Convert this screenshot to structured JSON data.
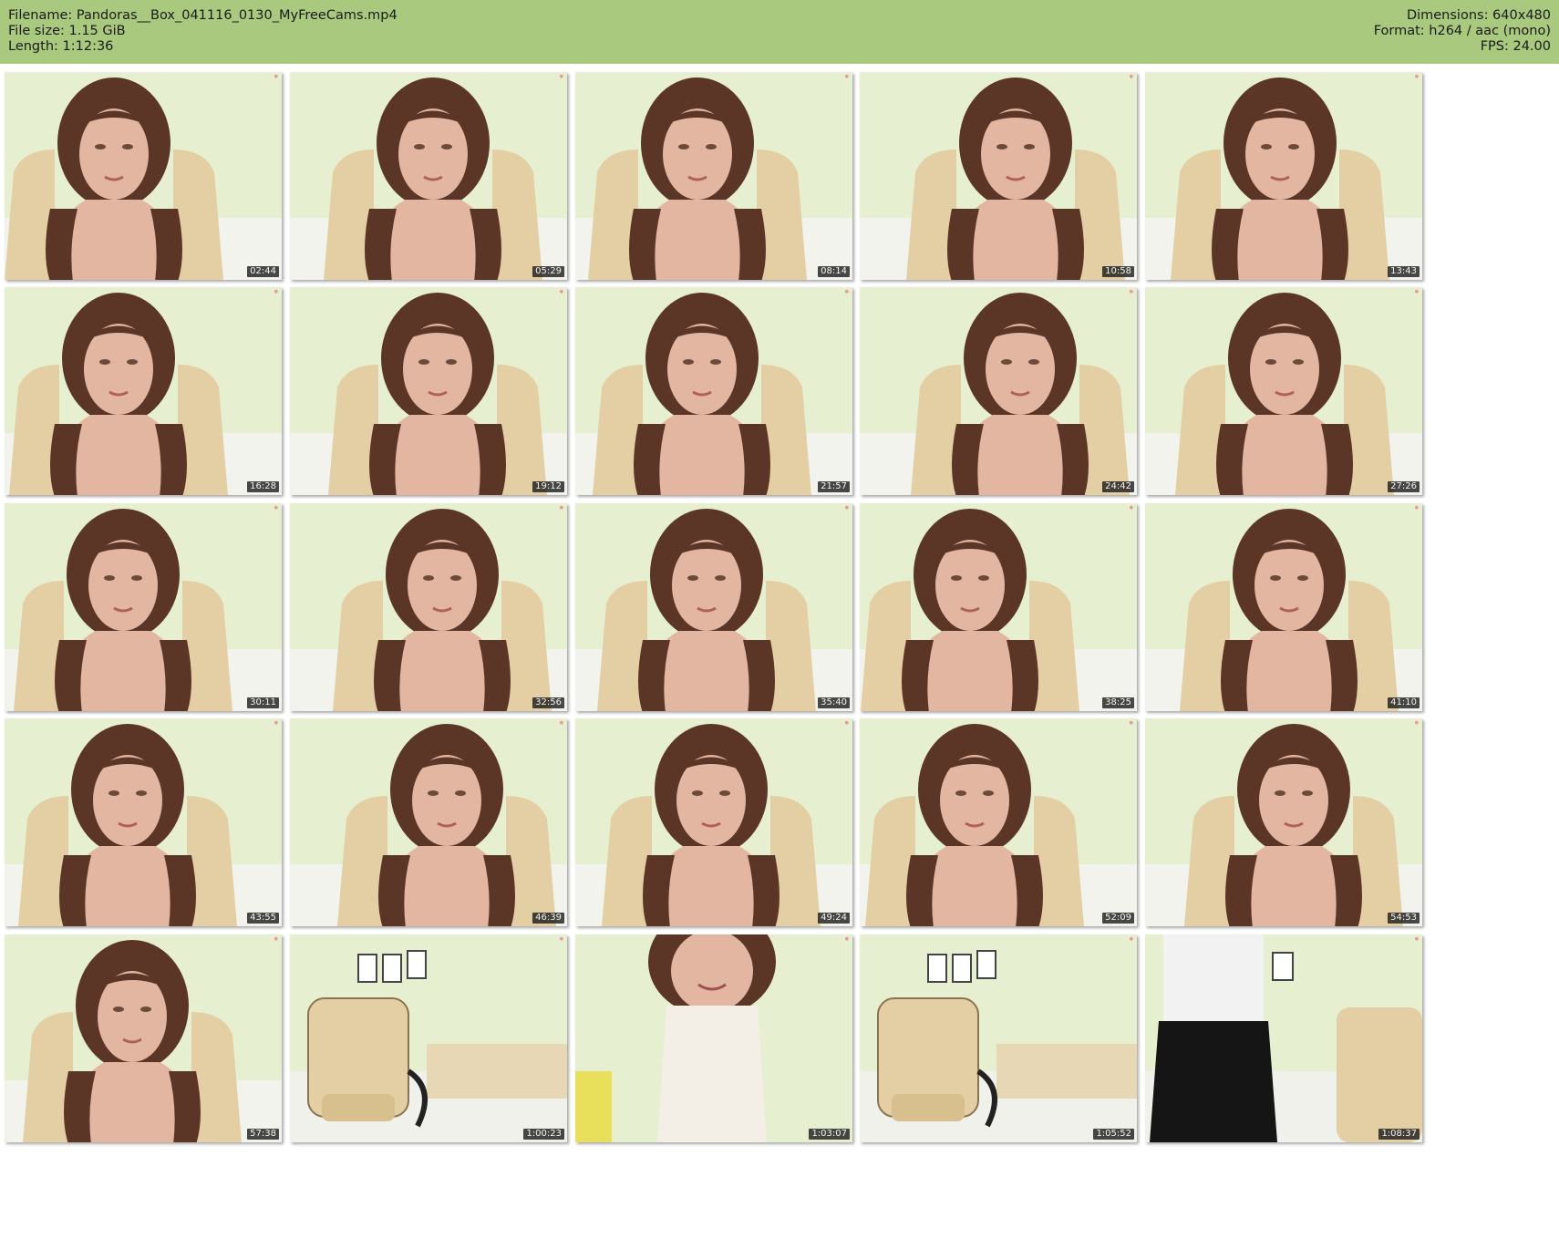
{
  "header": {
    "filename": "Filename: Pandoras__Box_041116_0130_MyFreeCams.mp4",
    "filesize": "File size: 1.15 GiB",
    "length": "Length: 1:12:36",
    "dimensions": "Dimensions: 640x480",
    "format": "Format: h264 / aac (mono)",
    "fps": "FPS: 24.00"
  },
  "colors": {
    "header_bg": "#a9c97f",
    "wall": "#e6efcf",
    "chair": "#e3cfa3",
    "hair": "#5b3526",
    "skin": "#e2b6a0"
  },
  "thumbnails": [
    {
      "time": "02:44",
      "scene": "person"
    },
    {
      "time": "05:29",
      "scene": "person"
    },
    {
      "time": "08:14",
      "scene": "person"
    },
    {
      "time": "10:58",
      "scene": "person"
    },
    {
      "time": "13:43",
      "scene": "person"
    },
    {
      "time": "16:28",
      "scene": "person"
    },
    {
      "time": "19:12",
      "scene": "person"
    },
    {
      "time": "21:57",
      "scene": "person"
    },
    {
      "time": "24:42",
      "scene": "person"
    },
    {
      "time": "27:26",
      "scene": "person"
    },
    {
      "time": "30:11",
      "scene": "person"
    },
    {
      "time": "32:56",
      "scene": "person"
    },
    {
      "time": "35:40",
      "scene": "person"
    },
    {
      "time": "38:25",
      "scene": "person"
    },
    {
      "time": "41:10",
      "scene": "person"
    },
    {
      "time": "43:55",
      "scene": "person"
    },
    {
      "time": "46:39",
      "scene": "person"
    },
    {
      "time": "49:24",
      "scene": "person"
    },
    {
      "time": "52:09",
      "scene": "person"
    },
    {
      "time": "54:53",
      "scene": "person"
    },
    {
      "time": "57:38",
      "scene": "person"
    },
    {
      "time": "1:00:23",
      "scene": "empty-chair"
    },
    {
      "time": "1:03:07",
      "scene": "person-close"
    },
    {
      "time": "1:05:52",
      "scene": "empty-chair"
    },
    {
      "time": "1:08:37",
      "scene": "standing"
    }
  ]
}
